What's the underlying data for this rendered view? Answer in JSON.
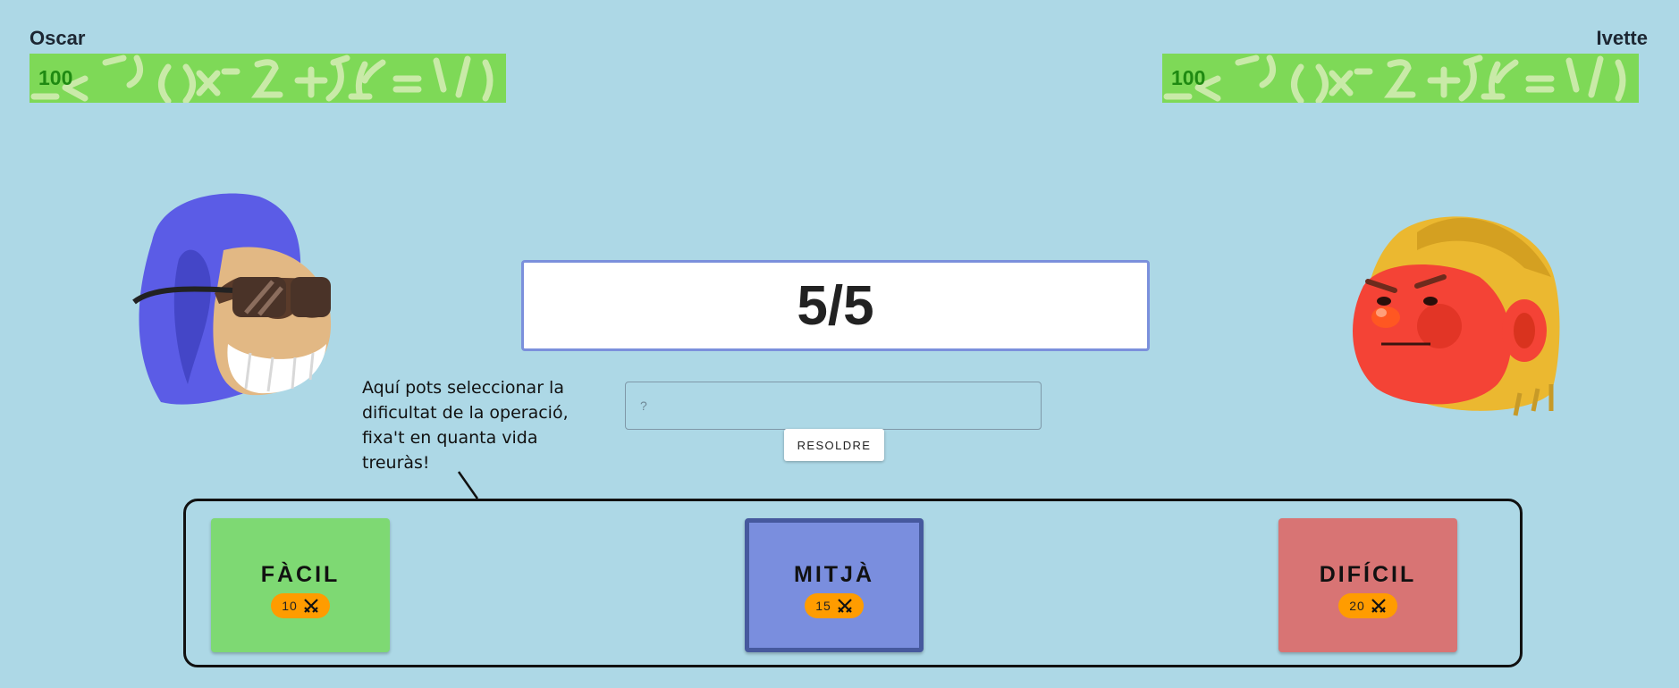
{
  "players": {
    "left": {
      "name": "Oscar",
      "health": 100,
      "health_fraction": 1.0,
      "avatar": "sunglasses-purple-hair-avatar"
    },
    "right": {
      "name": "Ivette",
      "health": 100,
      "health_fraction": 1.0,
      "avatar": "angry-red-face-avatar"
    }
  },
  "operation": {
    "text": "5/5"
  },
  "answer": {
    "placeholder": "?",
    "value": ""
  },
  "solve_button": {
    "label": "RESOLDRE"
  },
  "tooltip": {
    "text": "Aquí pots seleccionar la dificultat de la operació, fixa't en quanta vida treuràs!"
  },
  "difficulties": [
    {
      "label": "FÀCIL",
      "damage": "10",
      "color": "#7ed973",
      "selected": false
    },
    {
      "label": "MITJÀ",
      "damage": "15",
      "color": "#7a8ede",
      "selected": true
    },
    {
      "label": "DIFÍCIL",
      "damage": "20",
      "color": "#d87474",
      "selected": false
    }
  ],
  "icons": {
    "damage": "crossed-swords-icon"
  },
  "colors": {
    "background": "#add8e6",
    "health_bar": "#7ed957",
    "badge": "#ff9c00"
  }
}
